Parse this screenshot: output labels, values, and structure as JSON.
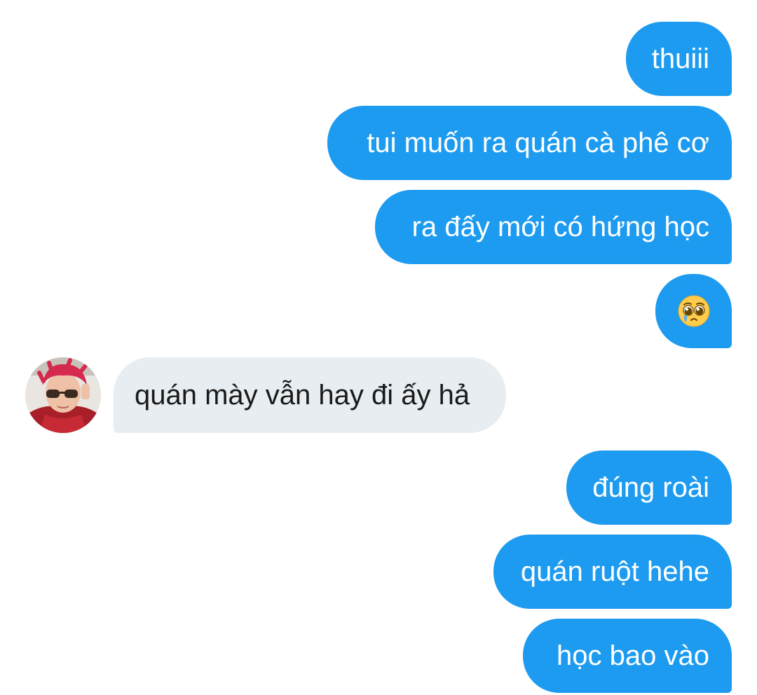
{
  "conversation": {
    "messages": [
      {
        "sender": "me",
        "text": "thuiii"
      },
      {
        "sender": "me",
        "text": "tui muốn ra quán cà phê cơ"
      },
      {
        "sender": "me",
        "text": "ra đấy mới có hứng học"
      },
      {
        "sender": "me",
        "emoji": "pleading-face-emoji"
      },
      {
        "sender": "other",
        "text": "quán mày vẫn hay đi ấy hả"
      },
      {
        "sender": "me",
        "text": "đúng roài"
      },
      {
        "sender": "me",
        "text": "quán ruột hehe"
      },
      {
        "sender": "me",
        "text": "học bao vào"
      }
    ]
  },
  "colors": {
    "sent_bubble": "#1d9bf0",
    "received_bubble": "#e8edf1",
    "sent_text": "#ffffff",
    "received_text": "#1a1a1a"
  }
}
